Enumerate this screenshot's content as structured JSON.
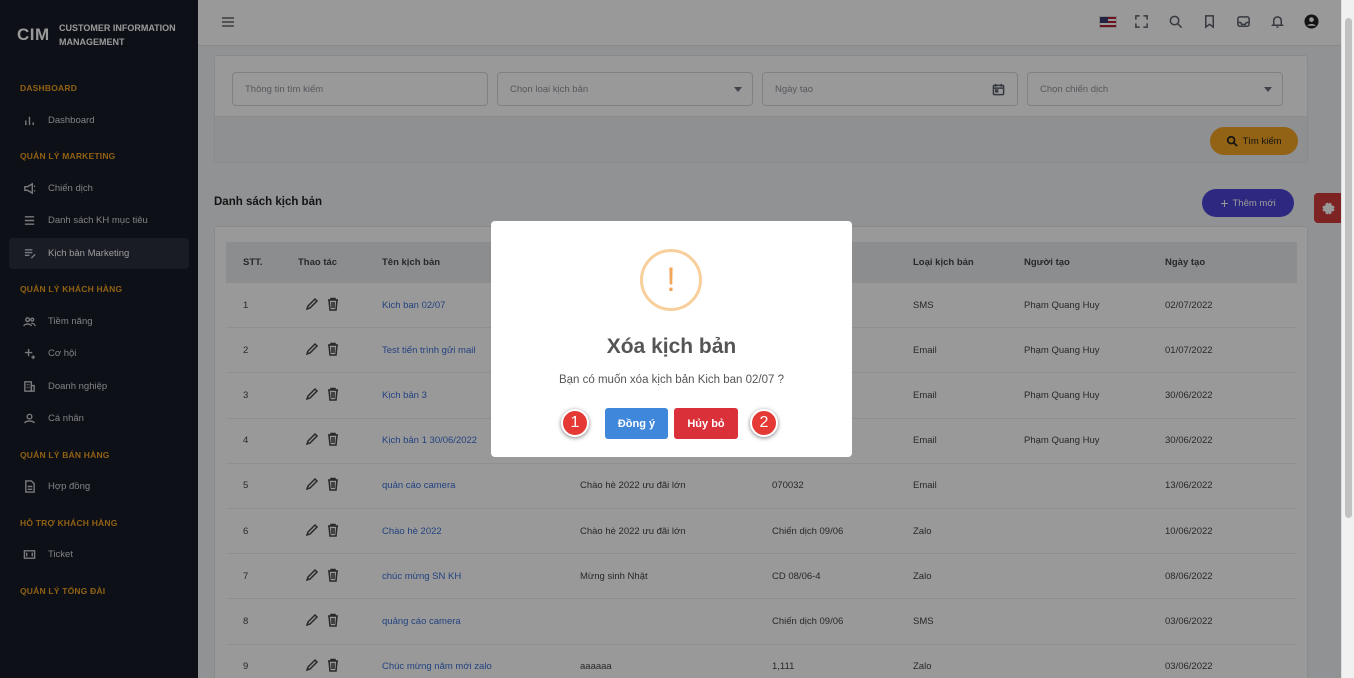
{
  "brand": {
    "logo": "CIM",
    "name": "CUSTOMER INFORMATION MANAGEMENT"
  },
  "sidebar": {
    "sections": [
      {
        "title": "DASHBOARD",
        "items": [
          {
            "label": "Dashboard",
            "icon": "bar-chart-icon"
          }
        ]
      },
      {
        "title": "QUẢN LÝ MARKETING",
        "items": [
          {
            "label": "Chiến dịch",
            "icon": "megaphone-icon"
          },
          {
            "label": "Danh sách KH mục tiêu",
            "icon": "list-icon"
          },
          {
            "label": "Kịch bản Marketing",
            "icon": "script-icon",
            "active": true
          }
        ]
      },
      {
        "title": "QUẢN LÝ KHÁCH HÀNG",
        "items": [
          {
            "label": "Tiềm năng",
            "icon": "users-icon"
          },
          {
            "label": "Cơ hội",
            "icon": "sparkle-icon"
          },
          {
            "label": "Doanh nghiệp",
            "icon": "building-icon"
          },
          {
            "label": "Cá nhân",
            "icon": "user-icon"
          }
        ]
      },
      {
        "title": "QUẢN LÝ BÁN HÀNG",
        "items": [
          {
            "label": "Hợp đồng",
            "icon": "document-icon"
          }
        ]
      },
      {
        "title": "HỖ TRỢ KHÁCH HÀNG",
        "items": [
          {
            "label": "Ticket",
            "icon": "ticket-icon"
          }
        ]
      },
      {
        "title": "QUẢN LÝ TỔNG ĐÀI",
        "items": []
      }
    ]
  },
  "filters": {
    "search_placeholder": "Thông tin tìm kiếm",
    "script_type_placeholder": "Chọn loại kịch bản",
    "date_placeholder": "Ngày tạo",
    "campaign_placeholder": "Chọn chiến dịch",
    "search_button": "Tìm kiếm"
  },
  "list": {
    "title": "Danh sách kịch bản",
    "add_button": "Thêm mới"
  },
  "table": {
    "headers": [
      "STT.",
      "Thao tác",
      "Tên kịch bản",
      "",
      "",
      "Loại kịch bản",
      "Người tạo",
      "Ngày tạo"
    ],
    "rows": [
      {
        "stt": "1",
        "name": "Kich ban 02/07",
        "subject": "",
        "campaign": "",
        "type": "SMS",
        "creator": "Phạm Quang Huy",
        "date": "02/07/2022"
      },
      {
        "stt": "2",
        "name": "Test tiến trình gửi mail",
        "subject": "",
        "campaign": "",
        "type": "Email",
        "creator": "Phạm Quang Huy",
        "date": "01/07/2022"
      },
      {
        "stt": "3",
        "name": "Kịch bản 3",
        "subject": "",
        "campaign": "",
        "type": "Email",
        "creator": "Phạm Quang Huy",
        "date": "30/06/2022"
      },
      {
        "stt": "4",
        "name": "Kịch bản 1 30/06/2022",
        "subject": "",
        "campaign": "",
        "type": "Email",
        "creator": "Phạm Quang Huy",
        "date": "30/06/2022"
      },
      {
        "stt": "5",
        "name": "quản cáo camera",
        "subject": "Chào hè 2022 ưu đãi lớn",
        "campaign": "070032",
        "type": "Email",
        "creator": "",
        "date": "13/06/2022"
      },
      {
        "stt": "6",
        "name": "Chào hè 2022",
        "subject": "Chào hè 2022 ưu đãi lớn",
        "campaign": "Chiến dịch 09/06",
        "type": "Zalo",
        "creator": "",
        "date": "10/06/2022"
      },
      {
        "stt": "7",
        "name": "chúc mừng SN KH",
        "subject": "Mừng sinh Nhật",
        "campaign": "CD 08/06-4",
        "type": "Zalo",
        "creator": "",
        "date": "08/06/2022"
      },
      {
        "stt": "8",
        "name": "quảng cáo camera",
        "subject": "",
        "campaign": "Chiến dịch 09/06",
        "type": "SMS",
        "creator": "",
        "date": "03/06/2022"
      },
      {
        "stt": "9",
        "name": "Chúc mừng năm mới zalo",
        "subject": "aaaaaa",
        "campaign": "1,111",
        "type": "Zalo",
        "creator": "",
        "date": "03/06/2022"
      }
    ]
  },
  "modal": {
    "icon": "!",
    "title": "Xóa kịch bản",
    "message": "Bạn có muốn xóa kịch bản Kich ban 02/07 ?",
    "confirm": "Đồng ý",
    "cancel": "Hủy bỏ",
    "marker1": "1",
    "marker2": "2"
  }
}
